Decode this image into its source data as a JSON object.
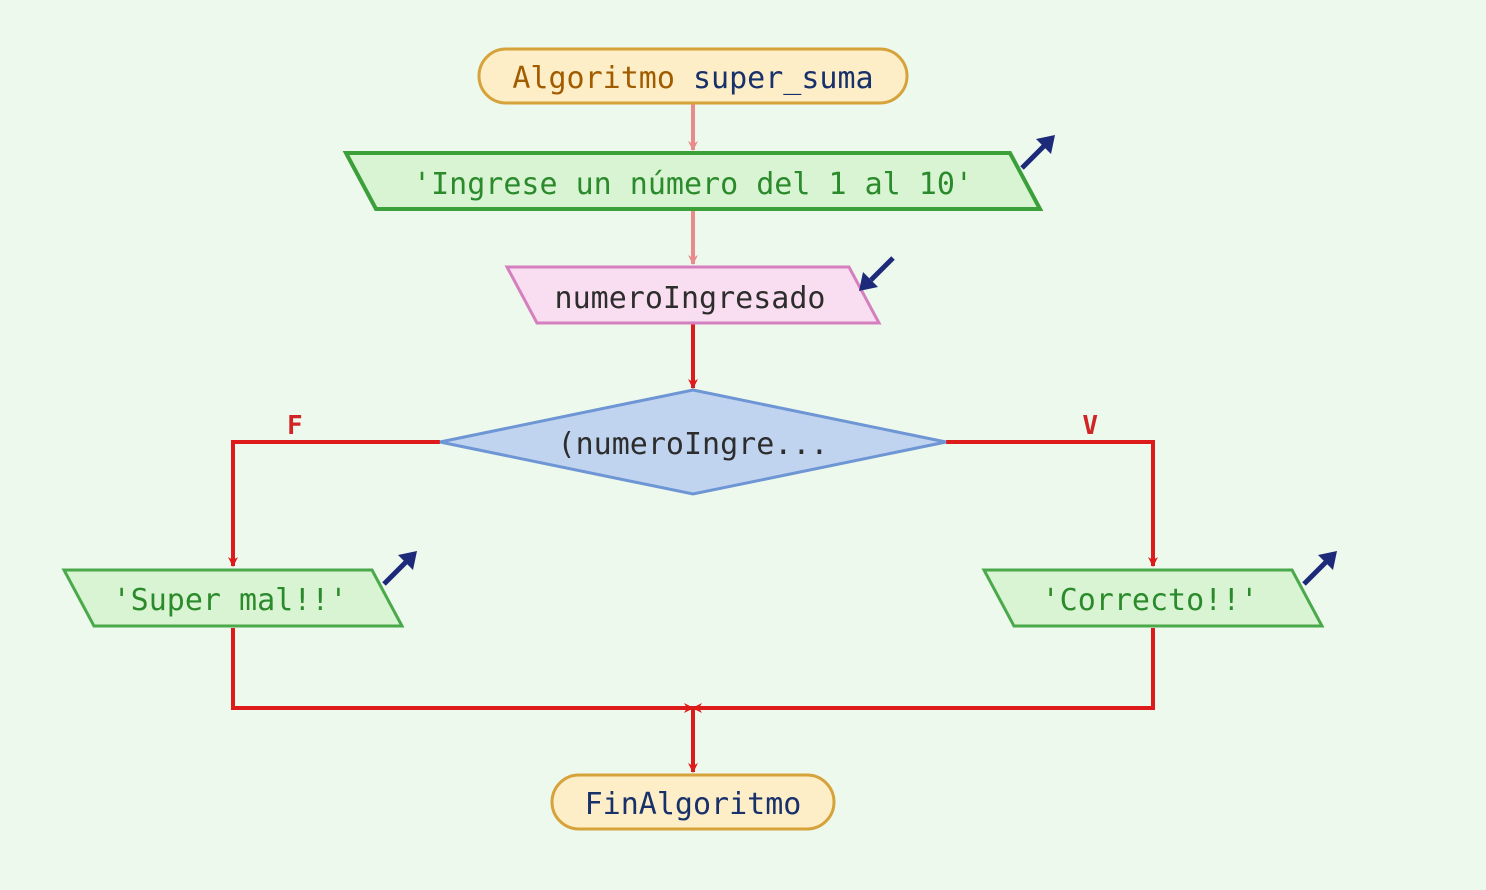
{
  "colors": {
    "bg": "#edf9ed",
    "arrow_red": "#dd1b1b",
    "arrow_pink": "#e98b8b",
    "terminal_fill": "#fdeec7",
    "terminal_stroke": "#d6a23a",
    "io_out_fill": "#d8f4d2",
    "io_out_stroke": "#4aa94a",
    "io_prompt_stroke": "#3b9f3a",
    "io_in_fill": "#f8def0",
    "io_in_stroke": "#d67fbe",
    "decision_fill": "#c0d4f0",
    "decision_stroke": "#6e96d4",
    "io_arrow": "#1d2a7a",
    "keyword": "#a15c00",
    "identifier": "#18316b",
    "string_text": "#2b8a2b",
    "body_text": "#2d2d2d"
  },
  "start": {
    "keyword": "Algoritmo",
    "name": "super_suma"
  },
  "prompt": {
    "text": "'Ingrese un número del 1 al 10'"
  },
  "input": {
    "variable": "numeroIngresado"
  },
  "decision": {
    "display_text": "(numeroIngre...",
    "false_label": "F",
    "true_label": "V"
  },
  "branch_false": {
    "text": "'Super mal!!'"
  },
  "branch_true": {
    "text": "'Correcto!!'"
  },
  "end": {
    "keyword": "FinAlgoritmo"
  }
}
